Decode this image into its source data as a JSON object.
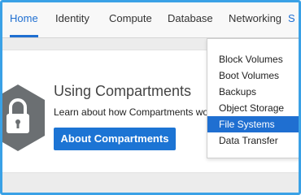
{
  "nav": {
    "items": [
      {
        "label": "Home"
      },
      {
        "label": "Identity"
      },
      {
        "label": "Compute"
      },
      {
        "label": "Database"
      },
      {
        "label": "Networking"
      },
      {
        "label": "S"
      }
    ],
    "active_color": "#1f6fd1"
  },
  "card": {
    "icon": "lock-shield-icon",
    "title": "Using Compartments",
    "description": "Learn about how Compartments wo",
    "button_label": "About Compartments",
    "button_color": "#1c74d4"
  },
  "dropdown": {
    "items": [
      {
        "label": "Block Volumes"
      },
      {
        "label": "Boot Volumes"
      },
      {
        "label": "Backups"
      },
      {
        "label": "Object Storage"
      },
      {
        "label": "File Systems"
      },
      {
        "label": "Data Transfer"
      }
    ],
    "highlighted": "File Systems",
    "highlight_color": "#1f6fd1"
  },
  "frame_color": "#3aa1e6"
}
